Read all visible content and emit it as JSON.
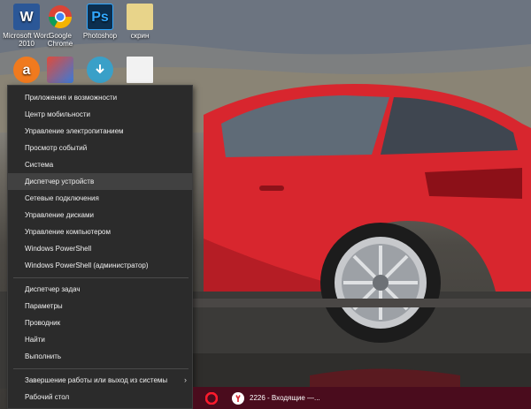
{
  "desktop_icons": [
    {
      "name": "word-2010",
      "label": "Microsoft Word 2010",
      "glyph": "W",
      "color": "#2b5797"
    },
    {
      "name": "google-chrome",
      "label": "Google Chrome",
      "glyph": "",
      "color": ""
    },
    {
      "name": "photoshop",
      "label": "Photoshop",
      "glyph": "Ps",
      "color": "#0c2f4f"
    },
    {
      "name": "skrin-folder",
      "label": "скрин",
      "glyph": "",
      "color": "#e8d48a"
    },
    {
      "name": "avast",
      "label": "",
      "glyph": "a",
      "color": "#f07a1e"
    },
    {
      "name": "installer",
      "label": "",
      "glyph": "",
      "color": ""
    },
    {
      "name": "download-app",
      "label": "",
      "glyph": "",
      "color": ""
    },
    {
      "name": "document",
      "label": "",
      "glyph": "",
      "color": ""
    }
  ],
  "menu": {
    "items": [
      {
        "label": "Приложения и возможности"
      },
      {
        "label": "Центр мобильности"
      },
      {
        "label": "Управление электропитанием"
      },
      {
        "label": "Просмотр событий"
      },
      {
        "label": "Система"
      },
      {
        "label": "Диспетчер устройств"
      },
      {
        "label": "Сетевые подключения"
      },
      {
        "label": "Управление дисками"
      },
      {
        "label": "Управление компьютером"
      },
      {
        "label": "Windows PowerShell"
      },
      {
        "label": "Windows PowerShell (администратор)"
      },
      {
        "label": "Диспетчер задач"
      },
      {
        "label": "Параметры"
      },
      {
        "label": "Проводник"
      },
      {
        "label": "Найти"
      },
      {
        "label": "Выполнить"
      },
      {
        "label": "Завершение работы или выход из системы"
      },
      {
        "label": "Рабочий стол"
      }
    ],
    "highlighted_item": "Диспетчер устройств",
    "submenu_icon": "chevron-right-icon"
  },
  "taskbar": {
    "items": [
      {
        "name": "opera-taskbar-button",
        "icon": "opera-icon",
        "label": ""
      },
      {
        "name": "yandex-browser-taskbar-button",
        "icon": "yandex-icon",
        "label": "2226 - Входящие —..."
      }
    ]
  },
  "colors": {
    "menu_bg": "#2b2b2b",
    "menu_hover": "#414141",
    "taskbar_bg": "#4a0c1d",
    "car_red": "#d8262e"
  }
}
